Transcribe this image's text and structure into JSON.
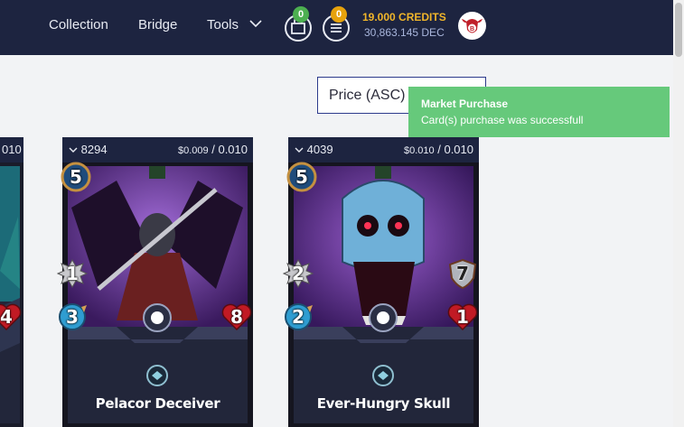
{
  "nav": {
    "collection": "Collection",
    "bridge": "Bridge",
    "tools": "Tools"
  },
  "header": {
    "cart_count": "0",
    "list_count": "0",
    "credits": "19.000 CREDITS",
    "dec": "30,863.145 DEC",
    "accent": "#f0b52a",
    "cart_badge_color": "#4caf50",
    "list_badge_color": "#e6a20c"
  },
  "sort": {
    "label": "Price (ASC)"
  },
  "toast": {
    "title": "Market Purchase",
    "message": "Card(s) purchase was successfull"
  },
  "cards": [
    {
      "qty": "8294",
      "price_current": "$0.009",
      "price_max": "/ 0.010",
      "name": "Pelacor Deceiver",
      "mana": "5",
      "attack": "1",
      "speed": "3",
      "health": "8",
      "armor": ""
    },
    {
      "qty": "4039",
      "price_current": "$0.010",
      "price_max": "/ 0.010",
      "name": "Ever-Hungry Skull",
      "mana": "5",
      "attack": "2",
      "speed": "2",
      "health": "1",
      "armor": "7"
    }
  ],
  "partial_card": {
    "price_tail": "010",
    "health": "4"
  }
}
